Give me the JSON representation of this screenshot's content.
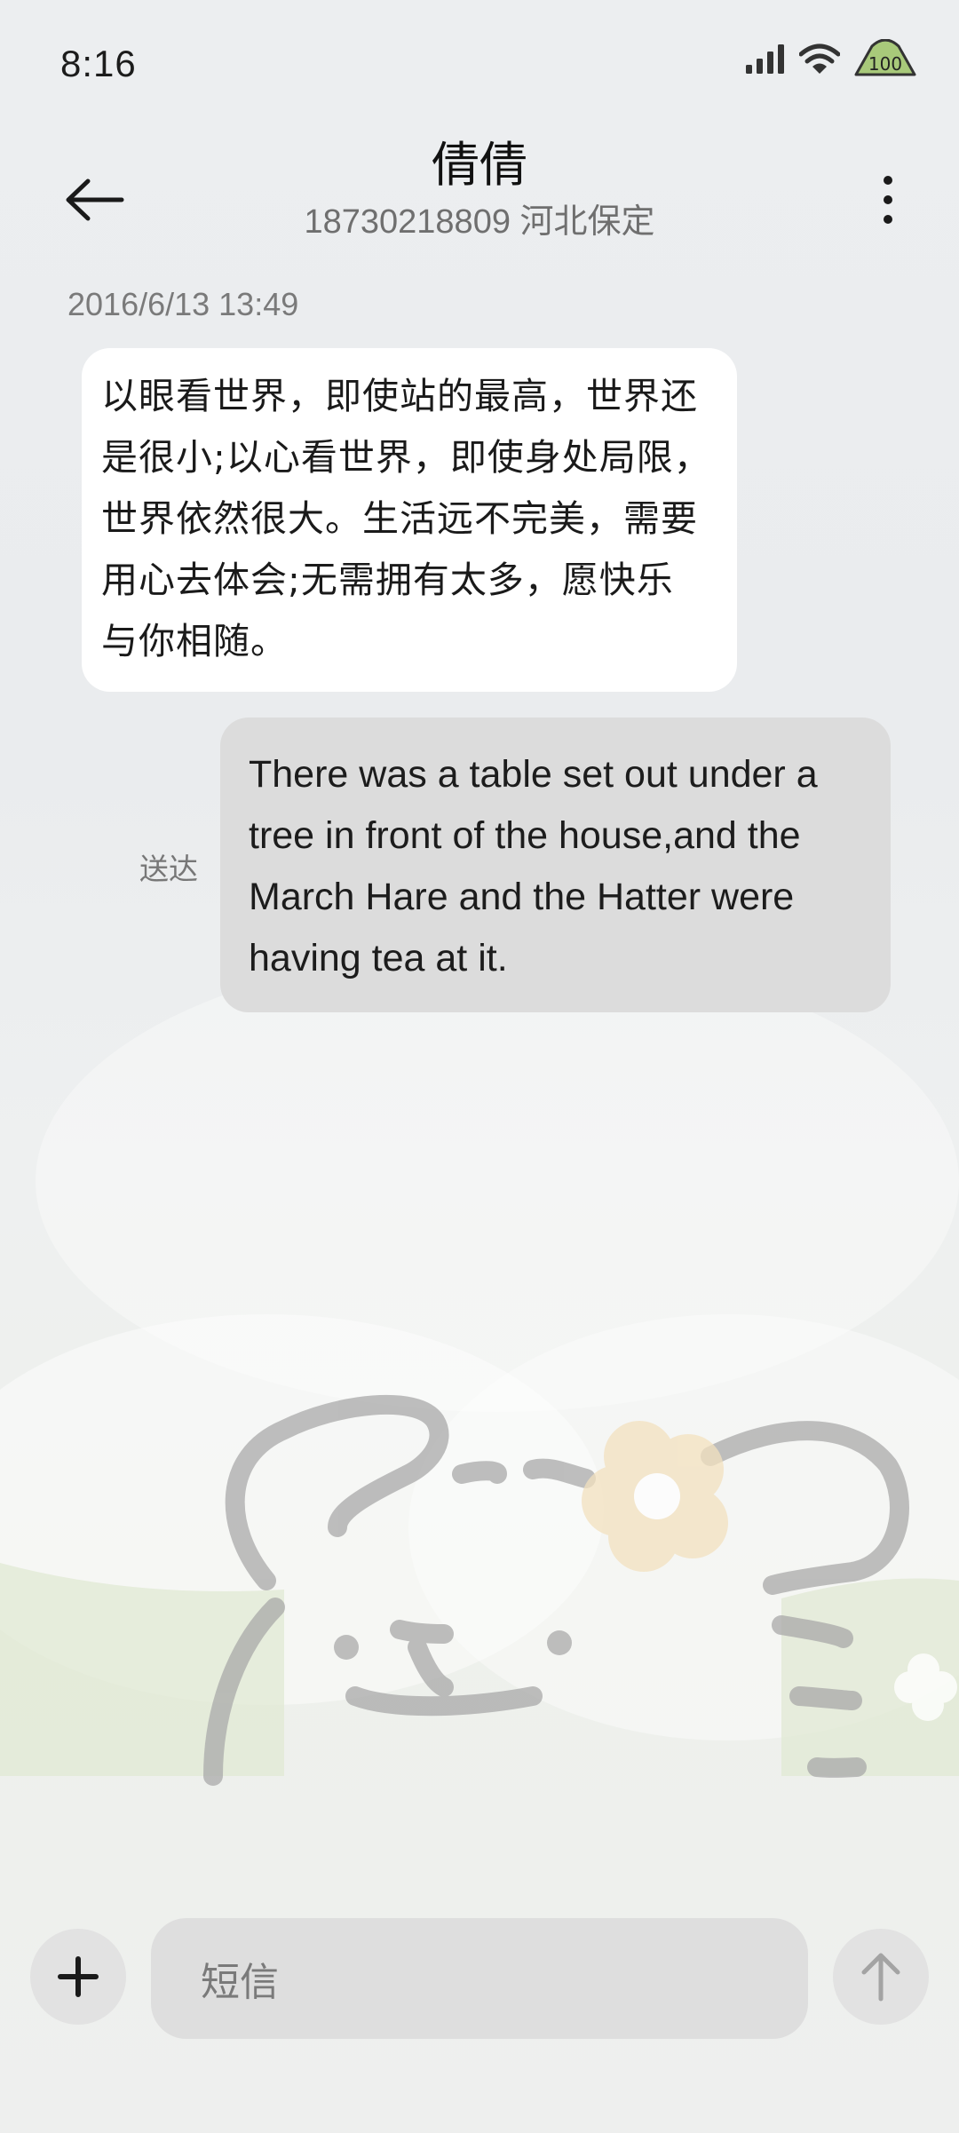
{
  "status_bar": {
    "time": "8:16",
    "battery": "100",
    "icons": [
      "signal-icon",
      "wifi-icon",
      "battery-icon"
    ]
  },
  "header": {
    "contact_name": "倩倩",
    "contact_subtitle": "18730218809 河北保定",
    "icons": [
      "back-arrow-icon",
      "more-vertical-icon"
    ]
  },
  "conversation": {
    "timestamp": "2016/6/13 13:49",
    "incoming": {
      "lines": [
        "以眼看世界，即使站的最高，世界还",
        "是很小;以心看世界，即使身处局限，",
        "世界依然很大。生活远不完美，需要",
        "用心去体会;无需拥有太多，愿快乐",
        "与你相随。"
      ]
    },
    "outgoing": {
      "lines": [
        "There was a table set out under a",
        "tree in front of the house,and the",
        "March Hare and the Hatter were",
        "having tea at it."
      ],
      "status": "送达"
    }
  },
  "composer": {
    "placeholder": "短信",
    "icons": [
      "plus-icon",
      "send-arrow-icon"
    ]
  },
  "colors": {
    "background": "#eceef0",
    "incoming_bubble": "#ffffff",
    "outgoing_bubble": "#dcdcdc",
    "battery_fill": "#a8c97a"
  }
}
